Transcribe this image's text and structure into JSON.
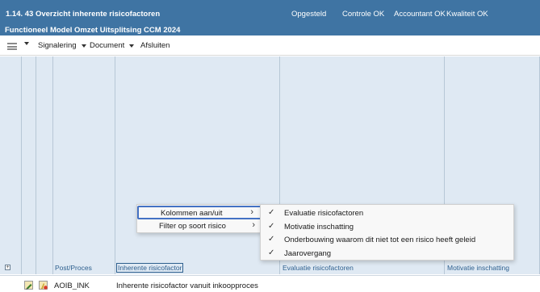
{
  "header": {
    "title": "1.14. 43 Overzicht inherente risicofactoren",
    "subtitle": "Functioneel Model Omzet Uitsplitsing CCM 2024",
    "statuses": [
      "Opgesteld",
      "Controle OK",
      "Accountant OK",
      "Kwaliteit OK"
    ]
  },
  "toolbar": {
    "menu_icon": "hamburger-icon",
    "signalering": "Signalering",
    "document": "Document",
    "afsluiten": "Afsluiten"
  },
  "grid": {
    "columns": [
      "Post/Proces",
      "Inherente risicofactor",
      "Evaluatie risicofactoren",
      "Motivatie inschatting"
    ],
    "expand_glyph": "+"
  },
  "row": {
    "code": "AOIB_INK",
    "description": "Inherente risicofactor vanuit inkoopproces"
  },
  "context_menu": {
    "items": [
      {
        "label": "Kolommen aan/uit",
        "arrow": "›"
      },
      {
        "label": "Filter op soort risico",
        "arrow": "›"
      }
    ]
  },
  "submenu": {
    "check_glyph": "✓",
    "items": [
      "Evaluatie risicofactoren",
      "Motivatie inschatting",
      "Onderbouwing waarom dit niet tot een risico heeft geleid",
      "Jaarovergang"
    ]
  },
  "colors": {
    "header_bg": "#3f74a3",
    "grid_bg": "#dfe9f3",
    "link": "#2d5f8e",
    "highlight_border": "#4472c4"
  }
}
